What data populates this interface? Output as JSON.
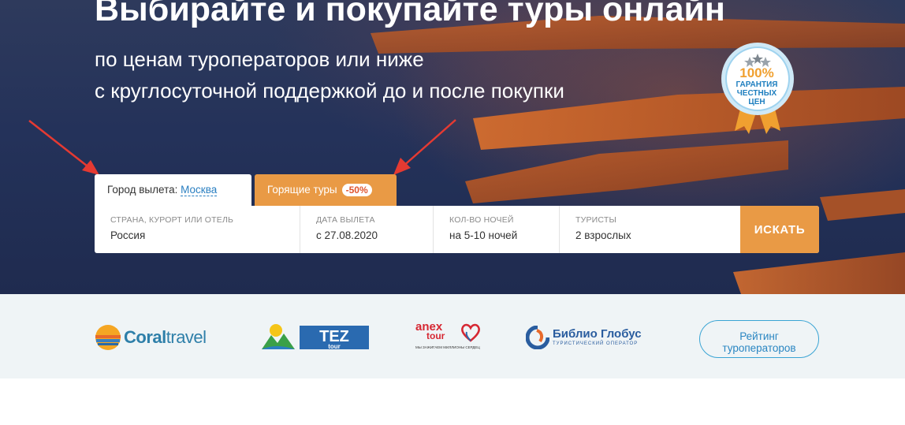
{
  "hero": {
    "title": "Выбирайте и покупайте туры онлайн",
    "subtitle_line1": "по ценам туроператоров или ниже",
    "subtitle_line2": "с круглосуточной поддержкой до и после покупки"
  },
  "badge": {
    "percent": "100%",
    "line1": "ГАРАНТИЯ",
    "line2": "ЧЕСТНЫХ",
    "line3": "ЦЕН"
  },
  "tabs": {
    "city_label": "Город вылета:",
    "city_value": "Москва",
    "hot_label": "Горящие туры",
    "hot_discount": "-50%"
  },
  "search": {
    "destination": {
      "label": "СТРАНА, КУРОРТ ИЛИ ОТЕЛЬ",
      "value": "Россия"
    },
    "date": {
      "label": "ДАТА ВЫЛЕТА",
      "value": "с 27.08.2020"
    },
    "nights": {
      "label": "КОЛ-ВО НОЧЕЙ",
      "value": "на 5-10 ночей"
    },
    "tourists": {
      "label": "ТУРИСТЫ",
      "value": "2 взрослых"
    },
    "button": "ИСКАТЬ"
  },
  "partners": {
    "coral": {
      "part1": "Coral",
      "part2": "travel"
    },
    "tez": {
      "part1": "TEZ",
      "part2": "tour"
    },
    "anex": {
      "brand": "anex",
      "tour": "tour",
      "slogan": "МЫ ЗАЖИГАЕМ МИЛЛИОНЫ СЕРДЕЦ"
    },
    "biblio": {
      "name": "Библио Глобус",
      "tagline": "ТУРИСТИЧЕСКИЙ ОПЕРАТОР"
    },
    "rating_line1": "Рейтинг",
    "rating_line2": "туроператоров"
  },
  "colors": {
    "accent_orange": "#e99a45",
    "link_blue": "#2a7fc1",
    "arrow_red": "#e53a32",
    "hero_dark": "#24325a",
    "strip_bg": "#eff4f6"
  }
}
